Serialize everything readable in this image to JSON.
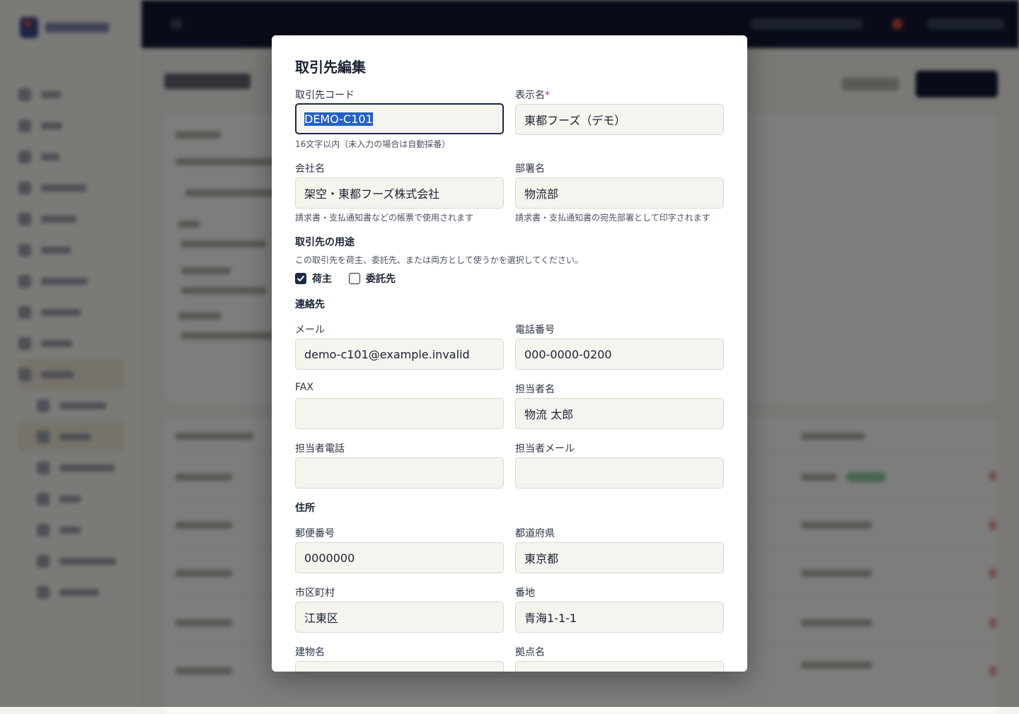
{
  "modal": {
    "title": "取引先編集",
    "fields": {
      "partner_code": {
        "label": "取引先コード",
        "value": "DEMO-C101",
        "help": "16文字以内（未入力の場合は自動採番）"
      },
      "display_name": {
        "label": "表示名",
        "required_mark": "*",
        "value": "東都フーズ（デモ）"
      },
      "company_name": {
        "label": "会社名",
        "value": "架空・東都フーズ株式会社",
        "help": "請求書・支払通知書などの帳票で使用されます"
      },
      "department": {
        "label": "部署名",
        "value": "物流部",
        "help": "請求書・支払通知書の宛先部署として印字されます"
      },
      "email": {
        "label": "メール",
        "value": "demo-c101@example.invalid"
      },
      "phone": {
        "label": "電話番号",
        "value": "000-0000-0200"
      },
      "fax": {
        "label": "FAX",
        "value": ""
      },
      "contact_name": {
        "label": "担当者名",
        "value": "物流 太郎"
      },
      "contact_phone": {
        "label": "担当者電話",
        "value": ""
      },
      "contact_email": {
        "label": "担当者メール",
        "value": ""
      },
      "postal_code": {
        "label": "郵便番号",
        "value": "0000000"
      },
      "prefecture": {
        "label": "都道府県",
        "value": "東京都"
      },
      "city": {
        "label": "市区町村",
        "value": "江東区"
      },
      "street": {
        "label": "番地",
        "value": "青海1-1-1"
      },
      "building": {
        "label": "建物名",
        "value": ""
      },
      "site_name": {
        "label": "拠点名",
        "value": ""
      }
    },
    "usage": {
      "heading": "取引先の用途",
      "description": "この取引先を荷主、委託先、または両方として使うかを選択してください。",
      "shipper": {
        "label": "荷主",
        "checked": true
      },
      "contractor": {
        "label": "委託先",
        "checked": false
      }
    },
    "sections": {
      "contact": "連絡先",
      "address": "住所"
    }
  }
}
